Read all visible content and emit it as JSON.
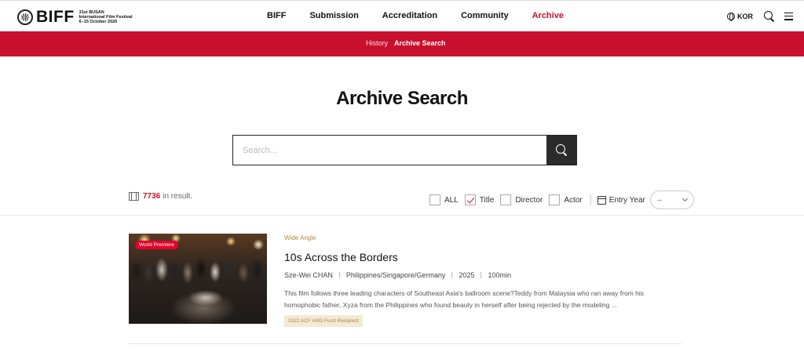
{
  "header": {
    "logo": {
      "wordmark": "BIFF",
      "line1": "31st BUSAN",
      "line2": "International Film Festival",
      "line3": "6–15 October 2026"
    },
    "nav": [
      {
        "label": "BIFF"
      },
      {
        "label": "Submission"
      },
      {
        "label": "Accreditation"
      },
      {
        "label": "Community"
      },
      {
        "label": "Archive",
        "active": true
      }
    ],
    "lang": "KOR"
  },
  "subnav": {
    "items": [
      {
        "label": "History"
      },
      {
        "label": "Archive Search",
        "active": true
      }
    ]
  },
  "page_title": "Archive Search",
  "search": {
    "placeholder": "Search...",
    "value": ""
  },
  "results": {
    "count": "7736",
    "count_suffix": "in result."
  },
  "filters": {
    "items": [
      {
        "label": "ALL",
        "checked": false
      },
      {
        "label": "Title",
        "checked": true
      },
      {
        "label": "Director",
        "checked": false
      },
      {
        "label": "Actor",
        "checked": false
      }
    ],
    "entry_year_label": "Entry Year",
    "entry_year_value": "--"
  },
  "cards": [
    {
      "badge": "World Premiere",
      "section": "Wide Angle",
      "title": "10s Across the Borders",
      "director": "Sze-Wei CHAN",
      "country": "Philippines/Singapore/Germany",
      "year": "2025",
      "runtime": "100min",
      "description": "This film follows three leading characters of Southeast Asia's ballroom scene?Teddy from Malaysia who ran away from his homophobic father, Xyza from the Philippines who found beauty in herself after being rejected by the modeling ...",
      "tag": "2022 ACF AND Fund Recipient"
    }
  ],
  "colors": {
    "accent": "#c8102e",
    "badge_red": "#e4002b",
    "section_gold": "#b08a3e",
    "tag_bg": "#f3ead3"
  }
}
